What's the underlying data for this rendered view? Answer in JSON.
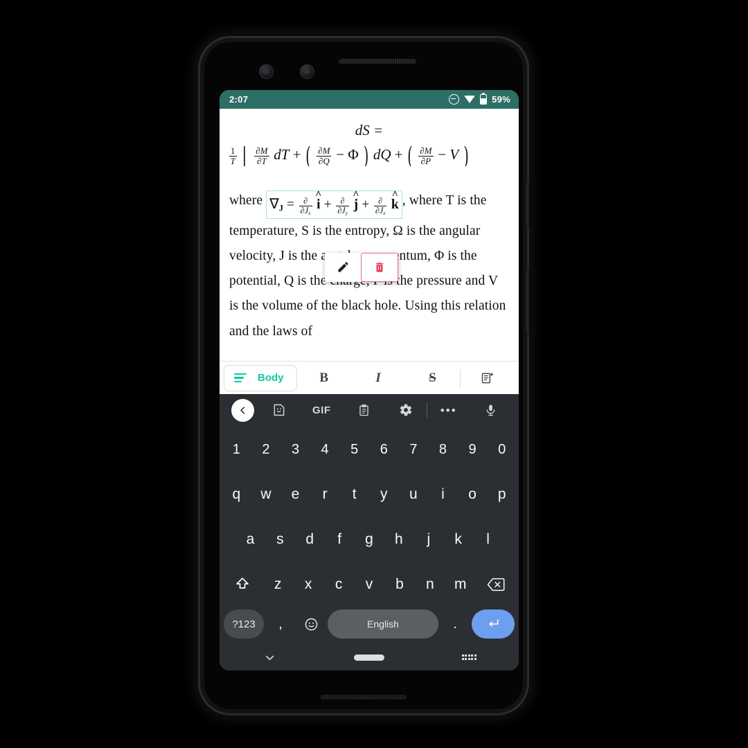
{
  "status_bar": {
    "time": "2:07",
    "battery": "59%",
    "icons": [
      "dnd-icon",
      "wifi-icon",
      "battery-icon"
    ],
    "background_color": "#2d6e67"
  },
  "document": {
    "display_equation": {
      "line1": "dS =",
      "line2_parts": {
        "one_over_t_num": "1",
        "one_over_t_den": "T",
        "bracket": "[",
        "f1_num": "∂M",
        "f1_den": "∂T",
        "dT": "dT",
        "plus1": "+",
        "lparen1": "(",
        "f2_num": "∂M",
        "f2_den": "∂Q",
        "minus1": "−",
        "phi": "Φ",
        "rparen1": ")",
        "dQ": "dQ",
        "plus2": "+",
        "lparen2": "(",
        "f3_num": "∂M",
        "f3_den": "∂P",
        "minus2": "−",
        "V": "V",
        "rparen2": ")"
      }
    },
    "paragraph": {
      "before_equation": "where",
      "inline_equation": {
        "nabla": "∇",
        "nabla_sub": "J",
        "equals": "=",
        "t1_num": "∂",
        "t1_den": "∂J",
        "t1_den_sub": "x",
        "t1_unit": "i",
        "plus1": "+",
        "t2_num": "∂",
        "t2_den": "∂J",
        "t2_den_sub": "y",
        "t2_unit": "j",
        "plus2": "+",
        "t3_num": "∂",
        "t3_den": "∂J",
        "t3_den_sub": "z",
        "t3_unit": "k"
      },
      "after_equation": ", where T is the temperature, S is the entropy, Ω is the angular velocity, J is the angular momentum, Φ is the potential, Q is the charge, P is the pressure and V is the volume of the black hole. Using this relation and the laws of"
    },
    "highlight_border_color": "#a9e3d6"
  },
  "edit_popup": {
    "edit_label": "edit-icon",
    "delete_label": "delete-icon",
    "delete_border_color": "#f06a85",
    "delete_icon_color": "#e8415f"
  },
  "format_toolbar": {
    "style_name": "Body",
    "style_accent_color": "#14c9a0",
    "bold": "B",
    "italic": "I",
    "strikethrough": "S",
    "insert_block": "add-block-icon"
  },
  "keyboard": {
    "toolbar": {
      "back": "back-chevron",
      "sticker": "sticker-icon",
      "gif": "GIF",
      "clipboard": "clipboard-icon",
      "settings": "gear-icon",
      "more": "•••",
      "mic": "microphone-icon"
    },
    "rows": {
      "numbers": [
        "1",
        "2",
        "3",
        "4",
        "5",
        "6",
        "7",
        "8",
        "9",
        "0"
      ],
      "top": [
        "q",
        "w",
        "e",
        "r",
        "t",
        "y",
        "u",
        "i",
        "o",
        "p"
      ],
      "home": [
        "a",
        "s",
        "d",
        "f",
        "g",
        "h",
        "j",
        "k",
        "l"
      ],
      "bottom": [
        "z",
        "x",
        "c",
        "v",
        "b",
        "n",
        "m"
      ]
    },
    "shift": "shift-icon",
    "backspace": "backspace-icon",
    "symbols_key": "?123",
    "comma_key": ",",
    "emoji_key": "emoji-icon",
    "space_key": "English",
    "period_key": ".",
    "enter_key": "enter-icon",
    "enter_color": "#6e9ef0",
    "background_color": "#2b2f33"
  },
  "nav_bar": {
    "hide_keyboard": "chevron-down-icon",
    "home": "home-pill",
    "switch_keyboard": "keyboard-switch-icon"
  }
}
